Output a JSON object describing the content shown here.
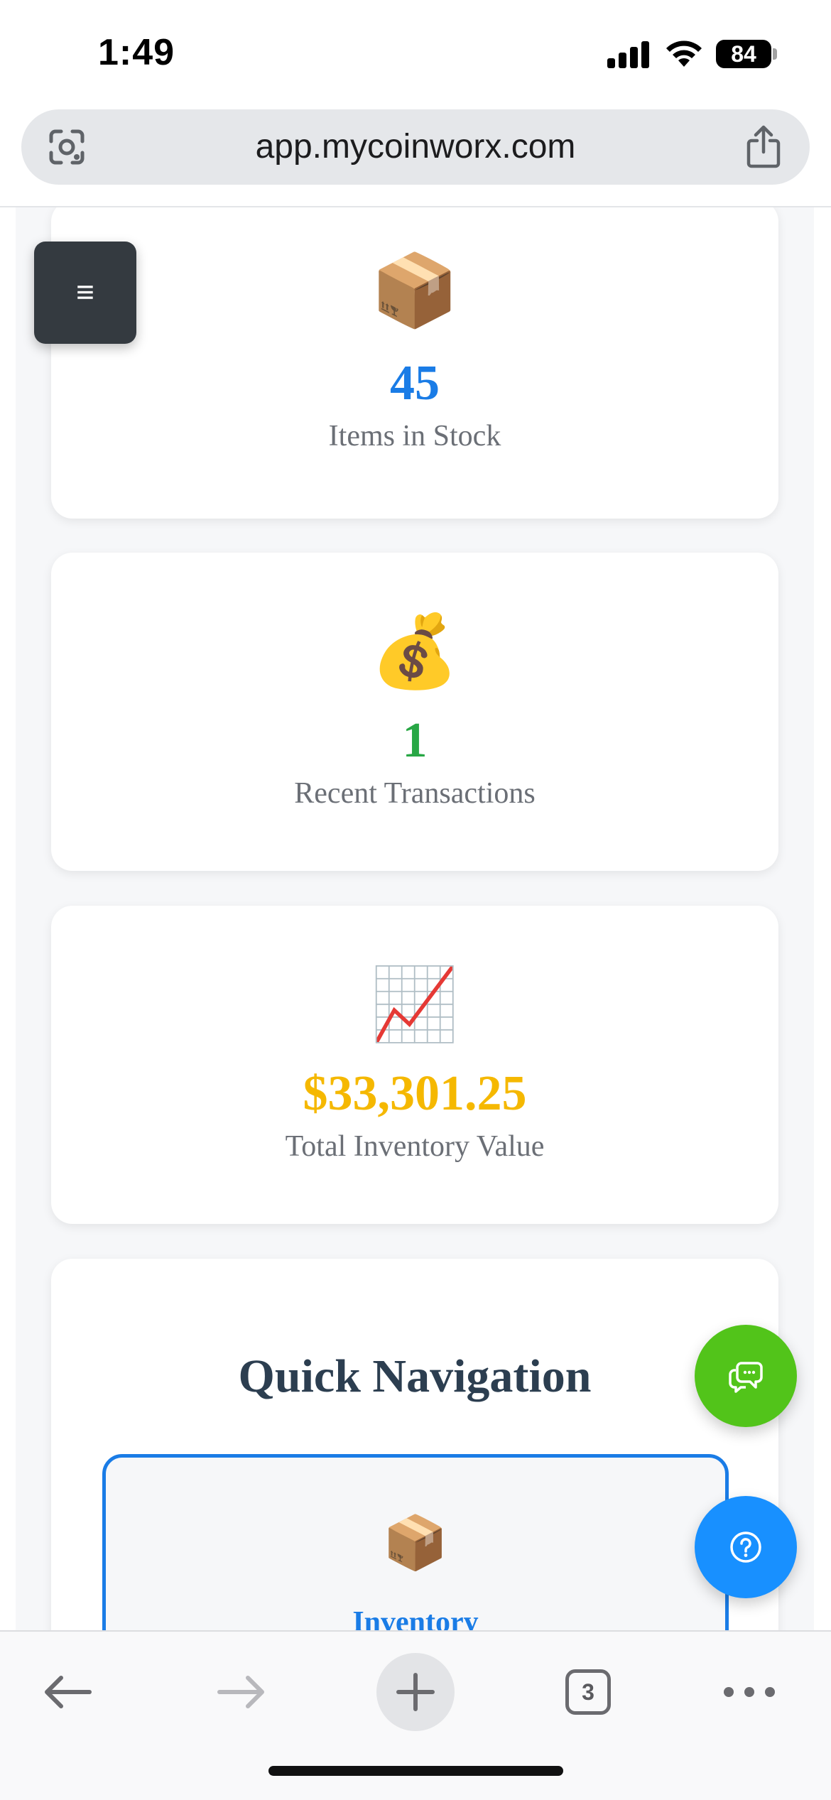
{
  "status_bar": {
    "time": "1:49",
    "battery": "84"
  },
  "browser": {
    "url": "app.mycoinworx.com",
    "tab_count": "3"
  },
  "menu_button": {
    "label": "≡"
  },
  "stats": [
    {
      "emoji": "📦",
      "value": "45",
      "label": "Items in Stock",
      "color": "#1a7ce6"
    },
    {
      "emoji": "💰",
      "value": "1",
      "label": "Recent Transactions",
      "color": "#28a745"
    },
    {
      "emoji": "📈",
      "value": "$33,301.25",
      "label": "Total Inventory Value",
      "color": "#f5b800"
    }
  ],
  "quick_nav": {
    "title": "Quick Navigation",
    "items": [
      {
        "emoji": "📦",
        "label": "Inventory"
      }
    ]
  },
  "colors": {
    "accent": "#1a7ce6",
    "chat_fab": "#52c41a",
    "help_fab": "#1890ff",
    "menu_bg": "#343a40"
  },
  "icons": {
    "lens": "google-lens-icon",
    "share": "share-icon",
    "chat": "chat-bubbles-icon",
    "help": "question-mark-icon",
    "back": "back-arrow-icon",
    "forward": "forward-arrow-icon",
    "new_tab": "plus-icon",
    "more": "more-dots-icon"
  }
}
